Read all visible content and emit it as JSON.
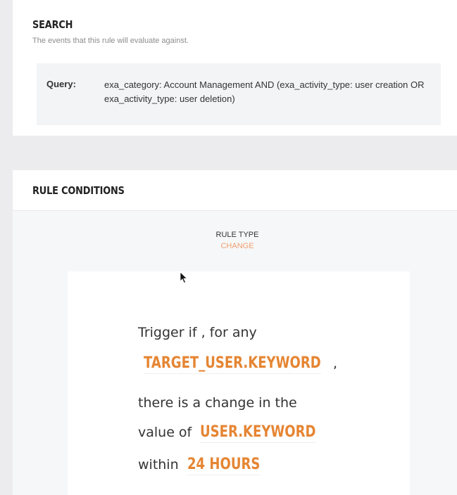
{
  "search": {
    "title": "SEARCH",
    "subtitle": "The events that this rule will evaluate against.",
    "query_label": "Query:",
    "query_value": "exa_category: Account Management AND (exa_activity_type: user creation OR exa_activity_type: user deletion)"
  },
  "rule_conditions": {
    "title": "RULE CONDITIONS",
    "rule_type_label": "RULE TYPE",
    "rule_type_value": "CHANGE"
  },
  "trigger": {
    "line1": "Trigger if , for any",
    "target_keyword": "TARGET_USER.KEYWORD",
    "comma": ",",
    "line3": "there is a change in the",
    "line4_prefix": "value of",
    "value_keyword": "USER.KEYWORD",
    "line5_prefix": "within",
    "window_keyword": "24 HOURS"
  },
  "colors": {
    "keyword": "#e58533",
    "rule_type": "#f0a070",
    "page_bg": "#ececee",
    "query_bg": "#f3f4f6"
  },
  "icons": {
    "cursor": "mouse-pointer-icon"
  }
}
